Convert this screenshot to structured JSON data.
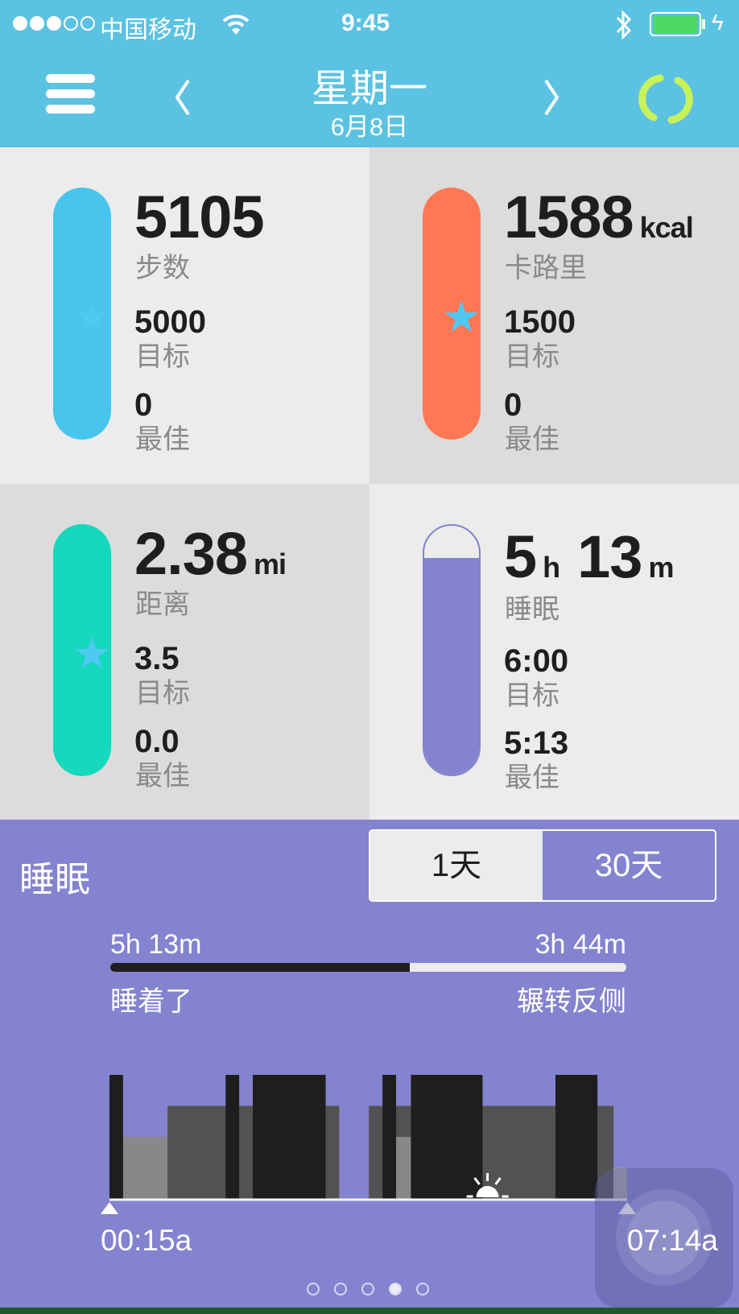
{
  "status_bar": {
    "carrier": "中国移动",
    "signal_bars": 3,
    "signal_total": 5,
    "time": "9:45",
    "battery_percent": 100,
    "battery_color": "#4cd964"
  },
  "header": {
    "title": "星期一",
    "date": "6月8日",
    "menu_icon": "hamburger-icon",
    "prev_icon": "chevron-left-icon",
    "next_icon": "chevron-right-icon",
    "sync_icon": "sync-icon",
    "sync_color": "#c8f25a"
  },
  "cards": [
    {
      "value": "5105",
      "unit": "",
      "label": "步数",
      "goal": "5000",
      "goal_label": "目标",
      "best": "0",
      "best_label": "最佳",
      "color": "#47c5ec",
      "fill": 1.0,
      "star": true
    },
    {
      "value": "1588",
      "unit": "kcal",
      "label": "卡路里",
      "goal": "1500",
      "goal_label": "目标",
      "best": "0",
      "best_label": "最佳",
      "color": "#ff7754",
      "fill": 1.0,
      "star": true
    },
    {
      "value": "2.38",
      "unit": "mi",
      "label": "距离",
      "goal": "3.5",
      "goal_label": "目标",
      "best": "0.0",
      "best_label": "最佳",
      "color": "#16d8bd",
      "fill": 1.0,
      "star": true
    },
    {
      "value_h": "5",
      "unit_h": "h",
      "value_m": "13",
      "unit_m": "m",
      "label": "睡眠",
      "goal": "6:00",
      "goal_label": "目标",
      "best": "5:13",
      "best_label": "最佳",
      "color": "#8383cf",
      "fill": 0.87,
      "star": false
    }
  ],
  "sleep_panel": {
    "title": "睡眠",
    "toggle": {
      "options": [
        "1天",
        "30天"
      ],
      "selected": "30天"
    },
    "asleep": "5h 13m",
    "asleep_label": "睡着了",
    "restless": "3h 44m",
    "restless_label": "辗转反侧",
    "asleep_fraction": 0.58,
    "start_time": "00:15a",
    "end_time": "07:14a",
    "page_dots": 5,
    "page_active": 3
  },
  "chart_data": {
    "type": "bar",
    "x_range": [
      "00:15",
      "07:14"
    ],
    "levels": {
      "4": "#1e1e1e",
      "3": "#525252",
      "2": "#888888",
      "1": "#a8a8a8"
    },
    "segments": [
      {
        "start": "00:26",
        "end": "01:02",
        "level": 2
      },
      {
        "start": "01:02",
        "end": "03:21",
        "level": 3
      },
      {
        "start": "03:45",
        "end": "07:03",
        "level": 3
      },
      {
        "start": "04:07",
        "end": "04:19",
        "level": 2
      },
      {
        "start": "07:03",
        "end": "07:14",
        "level": 1
      },
      {
        "start": "00:15",
        "end": "00:26",
        "level": 4
      },
      {
        "start": "01:49",
        "end": "02:00",
        "level": 4
      },
      {
        "start": "02:11",
        "end": "03:10",
        "level": 4
      },
      {
        "start": "03:56",
        "end": "04:07",
        "level": 4
      },
      {
        "start": "04:19",
        "end": "05:17",
        "level": 4
      },
      {
        "start": "06:16",
        "end": "06:50",
        "level": 4
      }
    ],
    "sunrise": "05:21"
  }
}
